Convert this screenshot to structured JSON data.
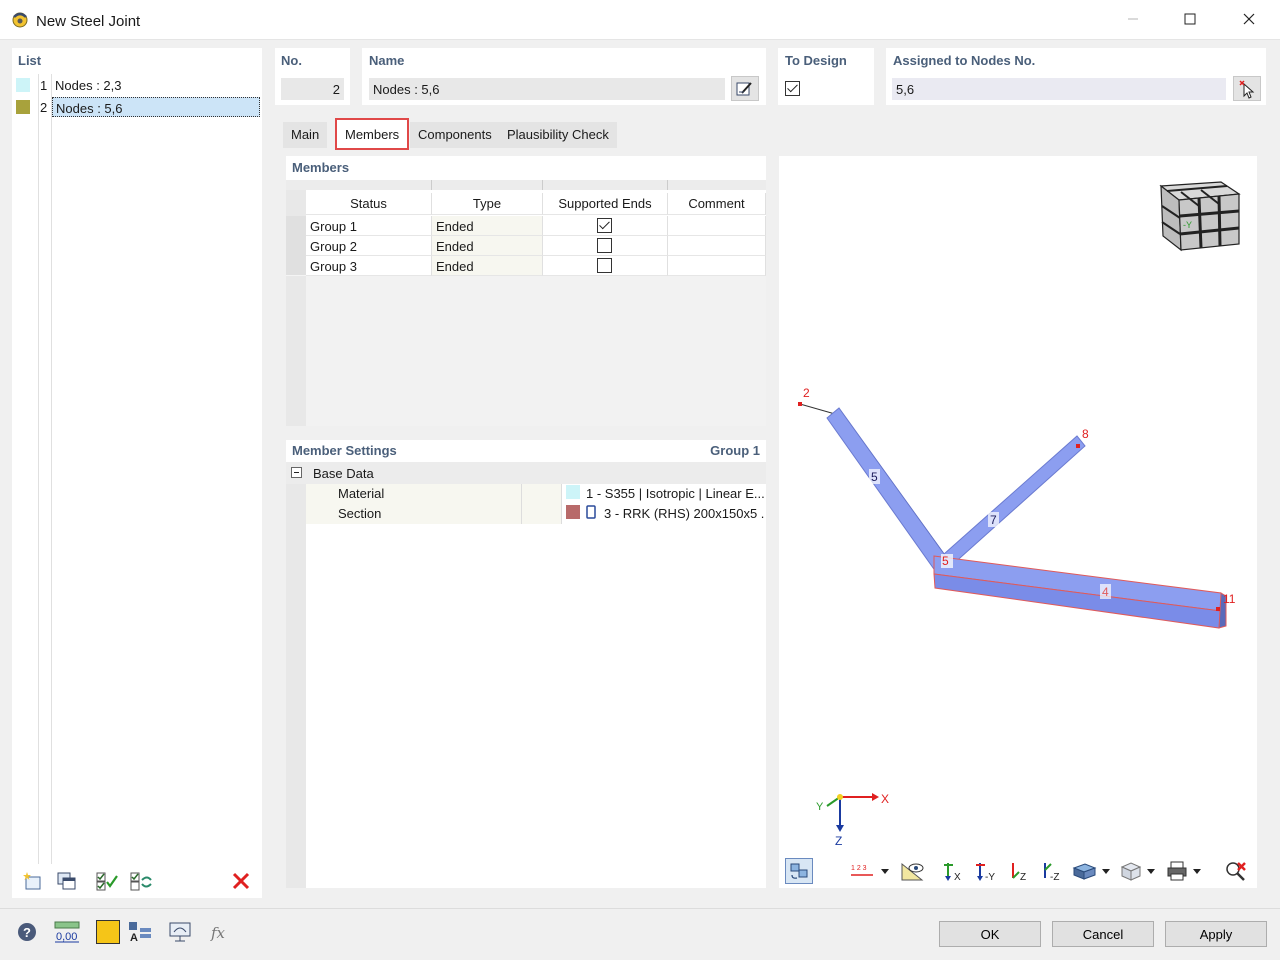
{
  "window": {
    "title": "New Steel Joint"
  },
  "list": {
    "title": "List",
    "items": [
      {
        "num": "1",
        "label": "Nodes : 2,3",
        "color": "#cdf4f8"
      },
      {
        "num": "2",
        "label": "Nodes : 5,6",
        "color": "#a8a23c"
      }
    ]
  },
  "header": {
    "no_label": "No.",
    "no_value": "2",
    "name_label": "Name",
    "name_value": "Nodes : 5,6",
    "to_design_label": "To Design",
    "to_design_checked": true,
    "assigned_label": "Assigned to Nodes No.",
    "assigned_value": "5,6"
  },
  "tabs": [
    {
      "label": "Main",
      "active": false
    },
    {
      "label": "Members",
      "active": true
    },
    {
      "label": "Components",
      "active": false
    },
    {
      "label": "Plausibility Check",
      "active": false
    }
  ],
  "members": {
    "title": "Members",
    "columns": [
      "Status",
      "Type",
      "Supported Ends",
      "Comment"
    ],
    "rows": [
      {
        "status": "Group 1",
        "type": "Ended",
        "supported": true,
        "comment": ""
      },
      {
        "status": "Group 2",
        "type": "Ended",
        "supported": false,
        "comment": ""
      },
      {
        "status": "Group 3",
        "type": "Ended",
        "supported": false,
        "comment": ""
      }
    ]
  },
  "member_settings": {
    "title": "Member Settings",
    "group": "Group 1",
    "section_label": "Base Data",
    "rows": [
      {
        "label": "Material",
        "value": "1 - S355 | Isotropic | Linear E...",
        "color": "#cdf4f8"
      },
      {
        "label": "Section",
        "value": "3 - RRK (RHS) 200x150x5 ...",
        "color": "#b86a6a"
      }
    ]
  },
  "view": {
    "node_labels": [
      "2",
      "8",
      "5",
      "11"
    ],
    "member_labels": [
      "5",
      "7",
      "4"
    ],
    "axes": {
      "x": "X",
      "y": "Y",
      "z": "Z"
    },
    "cube_label": "-Y",
    "scale_label": "1 2 3"
  },
  "bottom": {
    "value_icon": "0,00",
    "ok": "OK",
    "cancel": "Cancel",
    "apply": "Apply"
  },
  "colors": {
    "accent_red": "#e04848",
    "title_blue": "#4a5f7a",
    "member_blue": "#8c9ef0",
    "selection": "#cce4f7"
  }
}
